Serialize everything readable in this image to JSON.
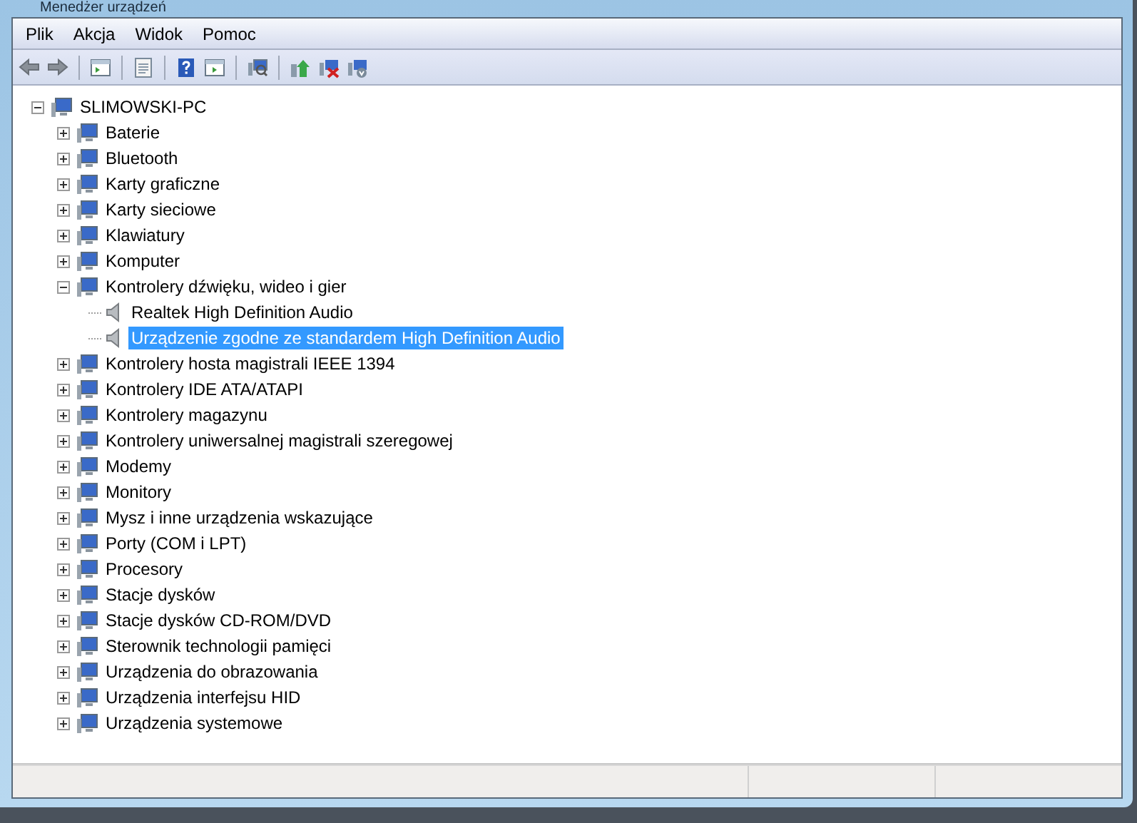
{
  "window": {
    "title": "Menedżer urządzeń"
  },
  "menu": [
    {
      "label": "Plik"
    },
    {
      "label": "Akcja"
    },
    {
      "label": "Widok"
    },
    {
      "label": "Pomoc"
    }
  ],
  "tree": {
    "label": "SLIMOWSKI-PC",
    "expanded": true,
    "selected": false,
    "children": [
      {
        "label": "Baterie",
        "expanded": false,
        "selected": false
      },
      {
        "label": "Bluetooth",
        "expanded": false,
        "selected": false
      },
      {
        "label": "Karty graficzne",
        "expanded": false,
        "selected": false
      },
      {
        "label": "Karty sieciowe",
        "expanded": false,
        "selected": false
      },
      {
        "label": "Klawiatury",
        "expanded": false,
        "selected": false
      },
      {
        "label": "Komputer",
        "expanded": false,
        "selected": false
      },
      {
        "label": "Kontrolery dźwięku, wideo i gier",
        "expanded": true,
        "selected": false,
        "children": [
          {
            "label": "Realtek High Definition Audio",
            "selected": false
          },
          {
            "label": "Urządzenie zgodne ze standardem High Definition Audio",
            "selected": true
          }
        ]
      },
      {
        "label": "Kontrolery hosta magistrali IEEE 1394",
        "expanded": false,
        "selected": false
      },
      {
        "label": "Kontrolery IDE ATA/ATAPI",
        "expanded": false,
        "selected": false
      },
      {
        "label": "Kontrolery magazynu",
        "expanded": false,
        "selected": false
      },
      {
        "label": "Kontrolery uniwersalnej magistrali szeregowej",
        "expanded": false,
        "selected": false
      },
      {
        "label": "Modemy",
        "expanded": false,
        "selected": false
      },
      {
        "label": "Monitory",
        "expanded": false,
        "selected": false
      },
      {
        "label": "Mysz i inne urządzenia wskazujące",
        "expanded": false,
        "selected": false
      },
      {
        "label": "Porty (COM i LPT)",
        "expanded": false,
        "selected": false
      },
      {
        "label": "Procesory",
        "expanded": false,
        "selected": false
      },
      {
        "label": "Stacje dysków",
        "expanded": false,
        "selected": false
      },
      {
        "label": "Stacje dysków CD-ROM/DVD",
        "expanded": false,
        "selected": false
      },
      {
        "label": "Sterownik technologii pamięci",
        "expanded": false,
        "selected": false
      },
      {
        "label": "Urządzenia do obrazowania",
        "expanded": false,
        "selected": false
      },
      {
        "label": "Urządzenia interfejsu HID",
        "expanded": false,
        "selected": false
      },
      {
        "label": "Urządzenia systemowe",
        "expanded": false,
        "selected": false
      }
    ]
  }
}
